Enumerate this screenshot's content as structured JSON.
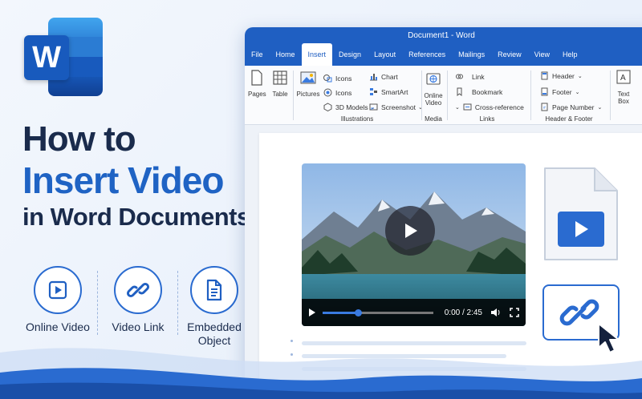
{
  "brand": {
    "logo_letter": "W",
    "accent": "#1f5fc2",
    "dark": "#1a2b4c"
  },
  "headline": {
    "line1": "How to",
    "line2": "Insert Video",
    "line3": "in Word Documents"
  },
  "features": [
    {
      "label": "Online Video",
      "icon": "play-square-icon"
    },
    {
      "label": "Video Link",
      "icon": "link-icon"
    },
    {
      "label": "Embedded Object",
      "icon": "document-icon"
    }
  ],
  "window": {
    "title": "Document1 - Word",
    "tabs": [
      "File",
      "Home",
      "Insert",
      "Design",
      "Layout",
      "References",
      "Mailings",
      "Review",
      "View",
      "Help"
    ],
    "active_tab": "Insert"
  },
  "ribbon": {
    "pages": "Pages",
    "table": "Table",
    "illustrations": {
      "pictures": "Pictures",
      "icons1": "Icons",
      "icons2": "Icons",
      "models": "3D Models",
      "chart": "Chart",
      "smartart": "SmartArt",
      "screenshot": "Screenshot",
      "label": "Illustrations"
    },
    "media": {
      "online_video_1": "Online",
      "online_video_2": "Video",
      "label": "Media"
    },
    "links": {
      "link": "Link",
      "bookmark": "Bookmark",
      "crossref": "Cross-reference",
      "label": "Links"
    },
    "header_footer": {
      "header": "Header",
      "footer": "Footer",
      "page_number": "Page Number",
      "label": "Header & Footer"
    },
    "text": {
      "textbox_1": "Text",
      "textbox_2": "Box"
    }
  },
  "video": {
    "time": "0:00 / 2:45",
    "progress": 0.32
  }
}
